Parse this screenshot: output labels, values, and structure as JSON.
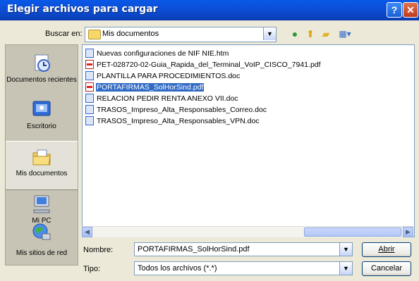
{
  "window": {
    "title": "Elegir archivos para cargar",
    "help_label": "?",
    "close_label": "✕"
  },
  "toolbar": {
    "look_in_label": "Buscar en:",
    "look_in_value": "Mis documentos",
    "dropdown_glyph": "▼"
  },
  "places": [
    {
      "label": "Documentos recientes",
      "icon": "recent-docs-icon"
    },
    {
      "label": "Escritorio",
      "icon": "desktop-icon"
    },
    {
      "label": "Mis documentos",
      "icon": "my-documents-icon"
    },
    {
      "label": "Mi PC",
      "icon": "my-computer-icon"
    },
    {
      "label": "Mis sitios de red",
      "icon": "network-places-icon"
    }
  ],
  "files": [
    {
      "name": "Nuevas configuraciones de NIF  NIE.htm",
      "type": "htm"
    },
    {
      "name": "PET-028720-02-Guia_Rapida_del_Terminal_VoIP_CISCO_7941.pdf",
      "type": "pdf"
    },
    {
      "name": "PLANTILLA PARA PROCEDIMIENTOS.doc",
      "type": "doc"
    },
    {
      "name": "PORTAFIRMAS_SolHorSind.pdf",
      "type": "pdf",
      "selected": true
    },
    {
      "name": "RELACION PEDIR RENTA ANEXO VII.doc",
      "type": "doc"
    },
    {
      "name": "TRASOS_Impreso_Alta_Responsables_Correo.doc",
      "type": "doc"
    },
    {
      "name": "TRASOS_Impreso_Alta_Responsables_VPN.doc",
      "type": "doc"
    }
  ],
  "scrollbar": {
    "left_glyph": "◀",
    "right_glyph": "▶"
  },
  "form": {
    "name_label": "Nombre:",
    "name_value": "PORTAFIRMAS_SolHorSind.pdf",
    "type_label": "Tipo:",
    "type_value": "Todos los archivos (*.*)",
    "open_label": "Abrir",
    "cancel_label": "Cancelar"
  }
}
